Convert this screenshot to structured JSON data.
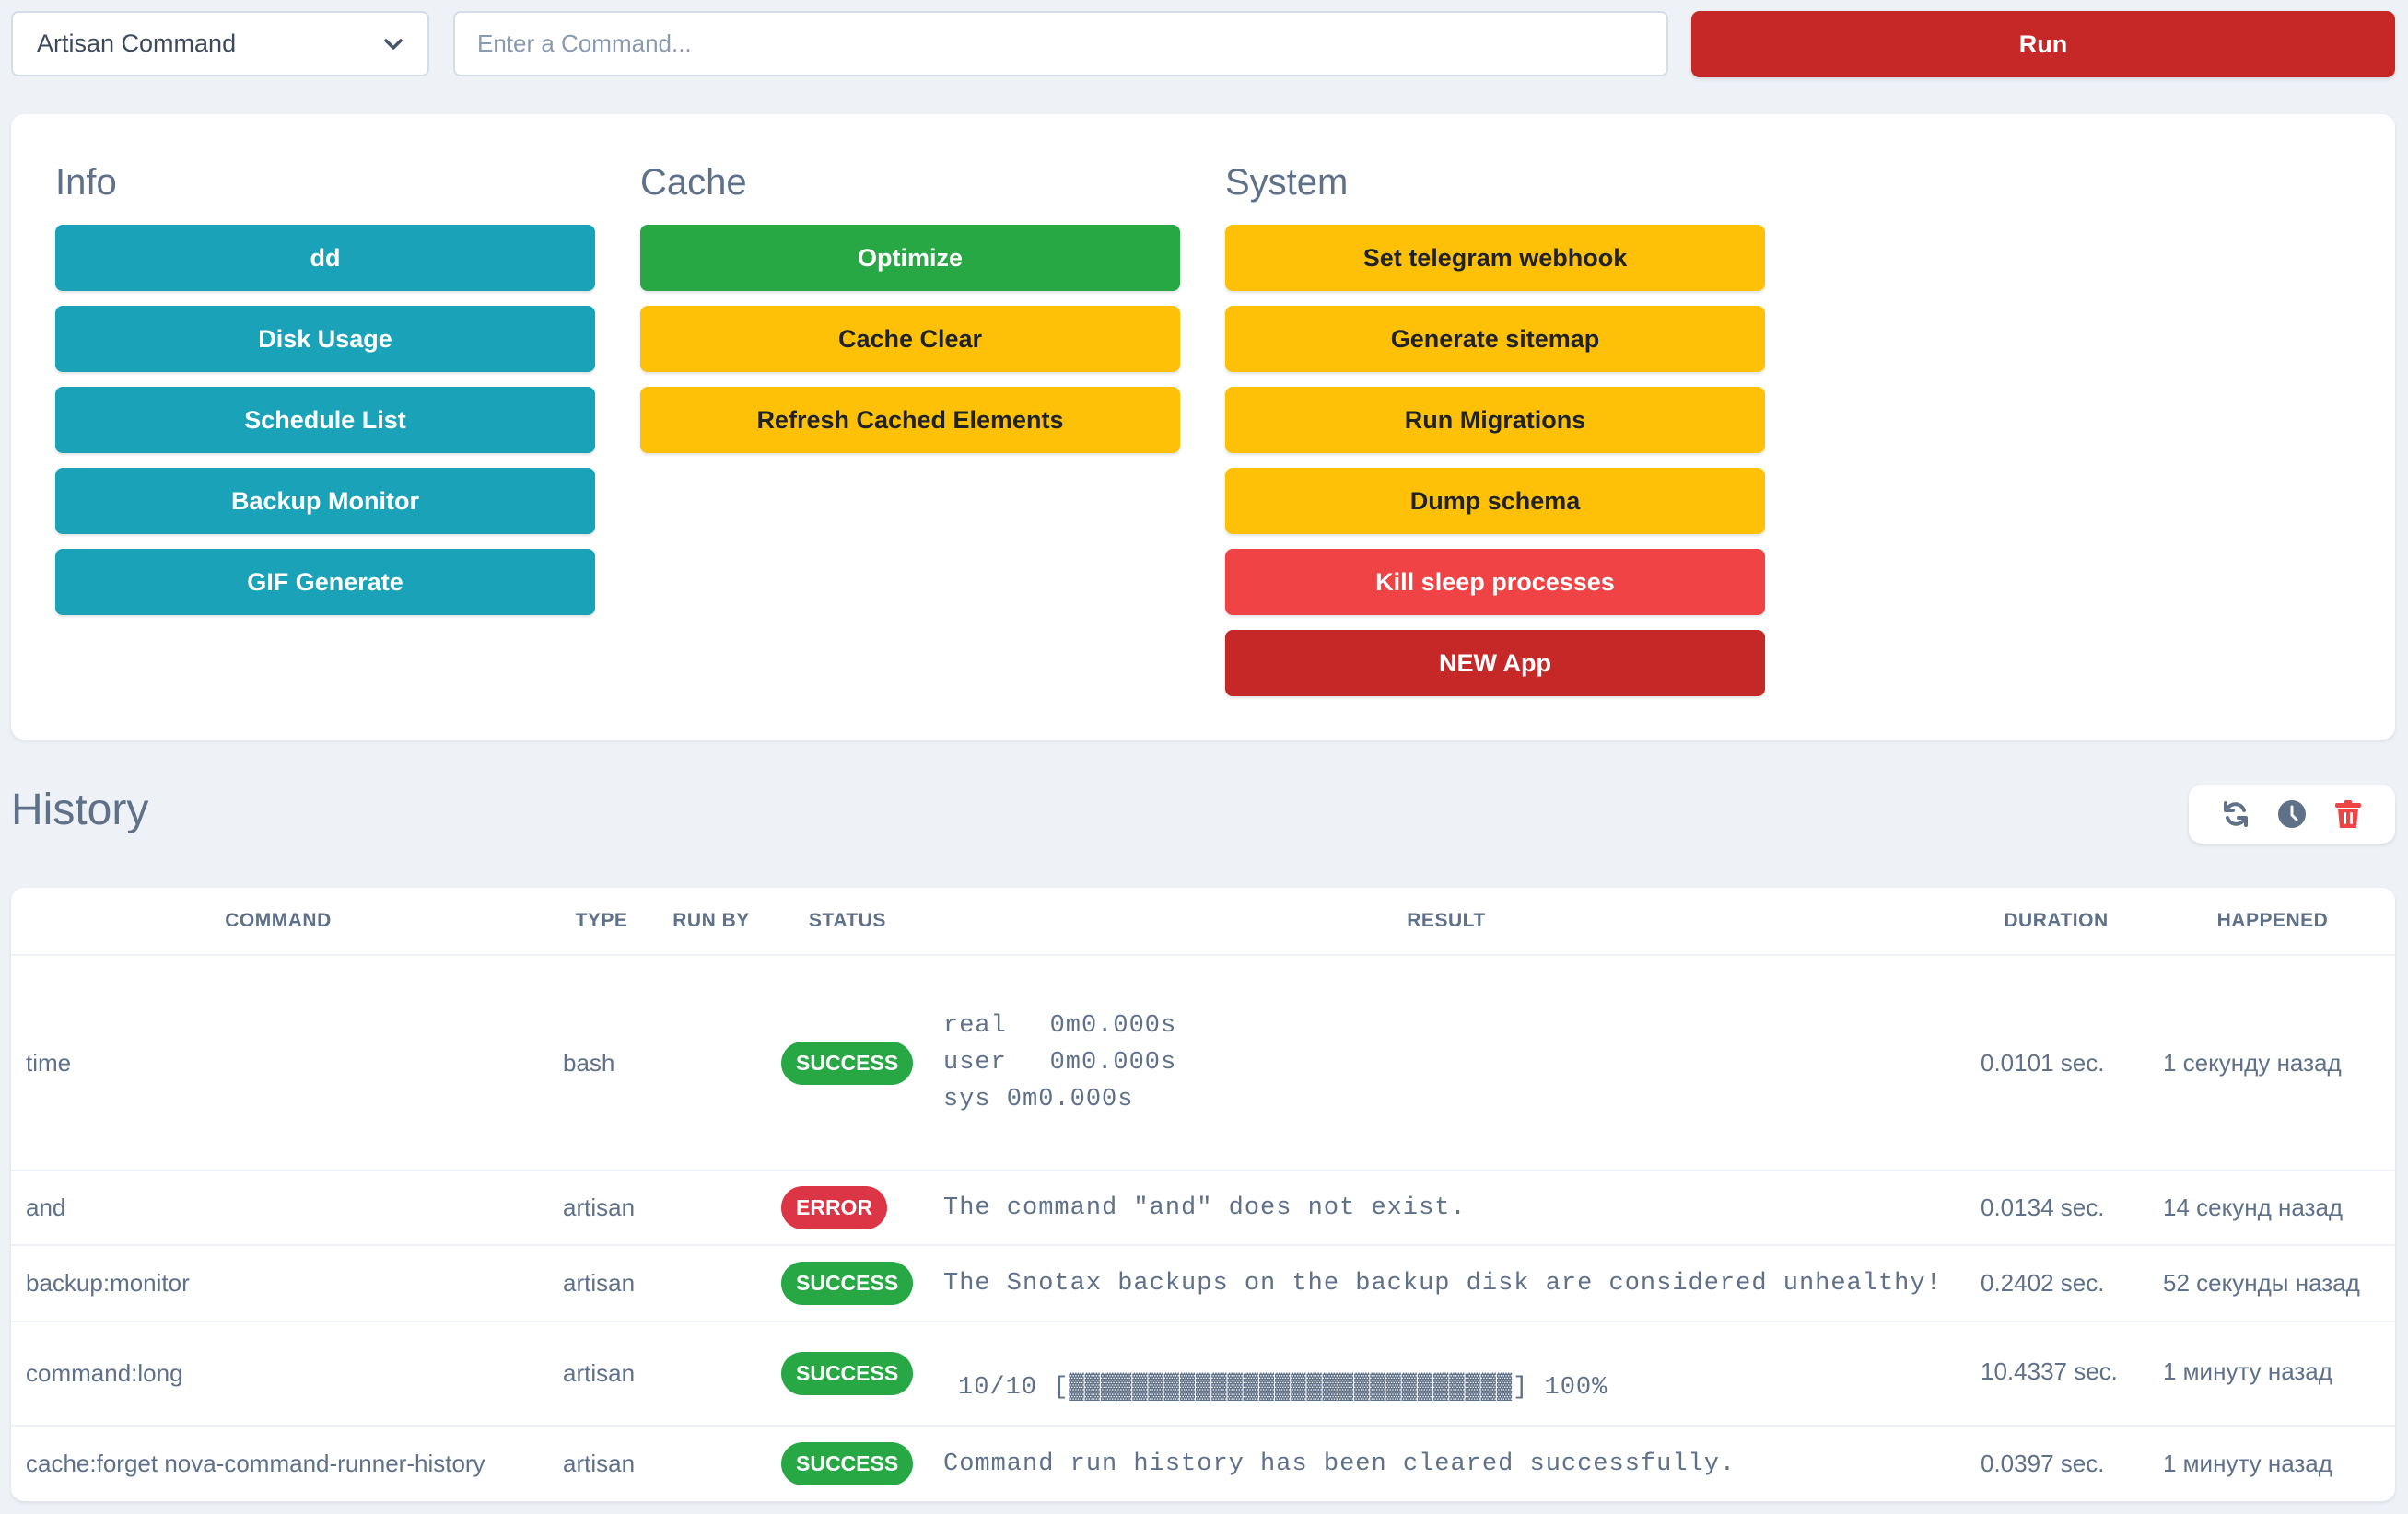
{
  "topbar": {
    "command_type": "Artisan Command",
    "command_placeholder": "Enter a Command...",
    "command_value": "",
    "run_label": "Run"
  },
  "groups": [
    {
      "title": "Info",
      "buttons": [
        {
          "label": "dd",
          "variant": "info"
        },
        {
          "label": "Disk Usage",
          "variant": "info"
        },
        {
          "label": "Schedule List",
          "variant": "info"
        },
        {
          "label": "Backup Monitor",
          "variant": "info"
        },
        {
          "label": "GIF Generate",
          "variant": "info"
        }
      ]
    },
    {
      "title": "Cache",
      "buttons": [
        {
          "label": "Optimize",
          "variant": "success"
        },
        {
          "label": "Cache Clear",
          "variant": "warning"
        },
        {
          "label": "Refresh Cached Elements",
          "variant": "warning"
        }
      ]
    },
    {
      "title": "System",
      "buttons": [
        {
          "label": "Set telegram webhook",
          "variant": "warning"
        },
        {
          "label": "Generate sitemap",
          "variant": "warning"
        },
        {
          "label": "Run Migrations",
          "variant": "warning"
        },
        {
          "label": "Dump schema",
          "variant": "warning"
        },
        {
          "label": "Kill sleep processes",
          "variant": "danger-light"
        },
        {
          "label": "NEW App",
          "variant": "danger"
        }
      ]
    }
  ],
  "history": {
    "title": "History",
    "toolbar": [
      "refresh-icon",
      "clock-icon",
      "trash-icon"
    ],
    "columns": [
      "Command",
      "Type",
      "Run By",
      "Status",
      "Result",
      "Duration",
      "Happened"
    ],
    "rows": [
      {
        "command": "time",
        "type": "bash",
        "run_by": "",
        "status": "SUCCESS",
        "result": "real\t0m0.000s\nuser\t0m0.000s\nsys 0m0.000s",
        "duration": "0.0101 sec.",
        "happened": "1 секунду назад"
      },
      {
        "command": "and",
        "type": "artisan",
        "run_by": "",
        "status": "ERROR",
        "result": "The command \"and\" does not exist.",
        "duration": "0.0134 sec.",
        "happened": "14 секунд назад"
      },
      {
        "command": "backup:monitor",
        "type": "artisan",
        "run_by": "",
        "status": "SUCCESS",
        "result": "The Snotax backups on the backup disk are considered unhealthy!",
        "duration": "0.2402 sec.",
        "happened": "52 секунды назад"
      },
      {
        "command": "command:long",
        "type": "artisan",
        "run_by": "",
        "status": "SUCCESS",
        "result": "10/10 [▓▓▓▓▓▓▓▓▓▓▓▓▓▓▓▓▓▓▓▓▓▓▓▓▓▓▓▓] 100%",
        "progress_percent": 100,
        "duration": "10.4337 sec.",
        "happened": "1 минуту назад"
      },
      {
        "command": "cache:forget nova-command-runner-history",
        "type": "artisan",
        "run_by": "",
        "status": "SUCCESS",
        "result": "Command run history has been cleared successfully.",
        "duration": "0.0397 sec.",
        "happened": "1 минуту назад"
      }
    ]
  },
  "colors": {
    "info": "#19a2b8",
    "success": "#28a745",
    "warning": "#fec107",
    "danger_light": "#ef4346",
    "danger": "#c62828",
    "badge_error": "#dc3545",
    "trash": "#ef4346",
    "icon": "#5f7089"
  }
}
